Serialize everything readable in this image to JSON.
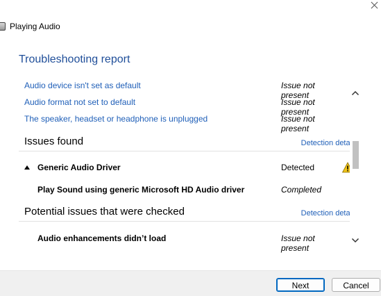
{
  "window": {
    "title": "Playing Audio"
  },
  "heading": "Troubleshooting report",
  "checked_rows": [
    {
      "label": "Audio device isn't set as default",
      "status": "Issue not present"
    },
    {
      "label": "Audio format not set to default",
      "status": "Issue not present"
    },
    {
      "label": "The speaker, headset or headphone is unplugged",
      "status": "Issue not present"
    }
  ],
  "issues_found": {
    "title": "Issues found",
    "details_link": "Detection details",
    "group": {
      "label": "Generic Audio Driver",
      "status": "Detected"
    },
    "item": {
      "label": "Play Sound using generic Microsoft HD Audio driver",
      "status": "Completed"
    }
  },
  "potential_issues": {
    "title": "Potential issues that were checked",
    "details_link": "Detection details",
    "item": {
      "label": "Audio enhancements didn’t load",
      "status": "Issue not present"
    }
  },
  "buttons": {
    "next": "Next",
    "cancel": "Cancel"
  },
  "colors": {
    "heading": "#1f4e99",
    "link": "#1f5fb8",
    "warning": "#f0c419",
    "footer_bg": "#f0f0f0",
    "primary_border": "#0067c0"
  },
  "icons": {
    "app": "speaker-icon",
    "warning": "warning-icon",
    "close": "close-icon"
  }
}
